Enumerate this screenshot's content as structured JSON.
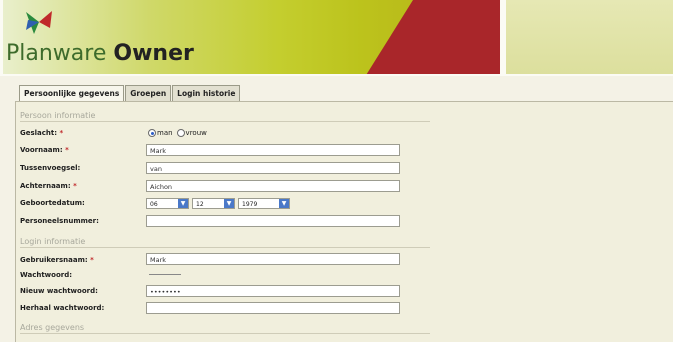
{
  "header": {
    "title_part1": "Planware",
    "title_part2": "Owner",
    "logo_icon": "planware-logo-icon"
  },
  "tabs": [
    {
      "label": "Persoonlijke gegevens",
      "active": true
    },
    {
      "label": "Groepen",
      "active": false
    },
    {
      "label": "Login historie",
      "active": false
    }
  ],
  "sections": {
    "persoon": "Persoon informatie",
    "login": "Login informatie",
    "adres": "Adres gegevens"
  },
  "persoon": {
    "geslacht_label": "Geslacht:",
    "geslacht_options": [
      "man",
      "vrouw"
    ],
    "geslacht_selected": "man",
    "voornaam_label": "Voornaam:",
    "voornaam_value": "Mark",
    "tussenvoegsel_label": "Tussenvoegsel:",
    "tussenvoegsel_value": "van",
    "achternaam_label": "Achternaam:",
    "achternaam_value": "Aichon",
    "geboortedatum_label": "Geboortedatum:",
    "geboorte_dag": "06",
    "geboorte_maand": "12",
    "geboorte_jaar": "1979",
    "personeelsnummer_label": "Personeelsnummer:",
    "personeelsnummer_value": ""
  },
  "login": {
    "gebruikersnaam_label": "Gebruikersnaam:",
    "gebruikersnaam_value": "Mark",
    "wachtwoord_label": "Wachtwoord:",
    "nieuw_wachtwoord_label": "Nieuw wachtwoord:",
    "nieuw_wachtwoord_value": "••••••••",
    "herhaal_wachtwoord_label": "Herhaal wachtwoord:",
    "herhaal_wachtwoord_value": ""
  },
  "required_mark": "*",
  "colors": {
    "required": "#c0292b",
    "accent_red": "#a9262a",
    "accent_yellow": "#c4ce2f"
  }
}
